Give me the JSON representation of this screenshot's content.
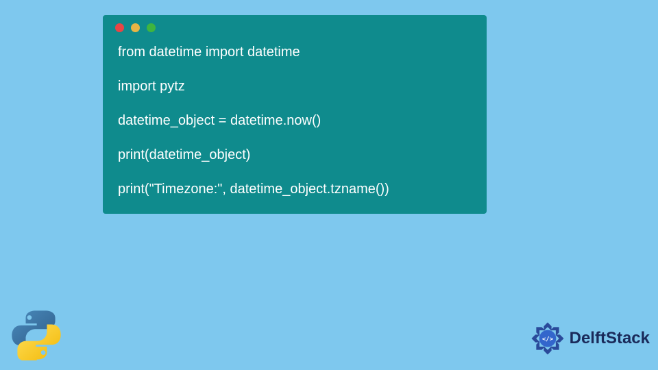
{
  "code": {
    "lines": [
      "from datetime import datetime",
      "import pytz",
      "datetime_object = datetime.now()",
      "print(datetime_object)",
      "print(\"Timezone:\", datetime_object.tzname())"
    ]
  },
  "branding": {
    "delftstack_label": "DelftStack"
  },
  "colors": {
    "bg": "#7ec8ee",
    "window": "#0f8b8d",
    "code_text": "#ffffff",
    "dot_red": "#e84545",
    "dot_yellow": "#e8b545",
    "dot_green": "#3fb53f",
    "brand_text": "#1a2a5a"
  }
}
